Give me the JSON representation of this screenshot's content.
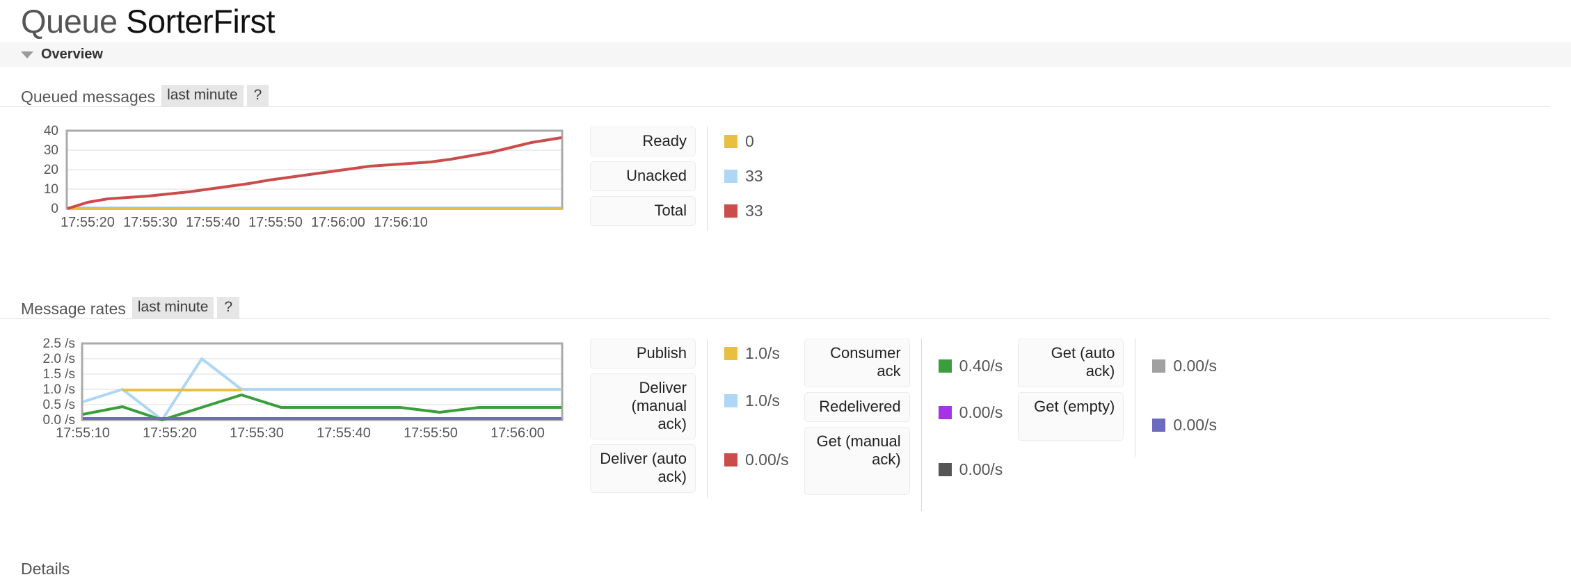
{
  "page": {
    "title_prefix": "Queue",
    "title_name": "SorterFirst",
    "section_title": "Overview",
    "details_title": "Details"
  },
  "colors": {
    "ready": "#e8bf3f",
    "unacked": "#aed6f5",
    "total": "#cc4b4b",
    "publish": "#e8bf3f",
    "deliver_manual": "#aed6f5",
    "deliver_auto": "#cc4b4b",
    "consumer_ack": "#3a9e3a",
    "redelivered": "#a733e8",
    "get_manual": "#555555",
    "get_auto": "#a0a0a0",
    "get_empty": "#6d6bbf"
  },
  "queued_messages": {
    "title": "Queued messages",
    "period": "last minute",
    "help": "?",
    "legend": [
      {
        "label": "Ready",
        "value": "0",
        "color_key": "ready"
      },
      {
        "label": "Unacked",
        "value": "33",
        "color_key": "unacked"
      },
      {
        "label": "Total",
        "value": "33",
        "color_key": "total"
      }
    ]
  },
  "message_rates": {
    "title": "Message rates",
    "period": "last minute",
    "help": "?",
    "legend_groups": [
      [
        {
          "label": "Publish",
          "value": "1.0/s",
          "color_key": "publish"
        },
        {
          "label": "Deliver (manual ack)",
          "value": "1.0/s",
          "color_key": "deliver_manual"
        },
        {
          "label": "Deliver (auto ack)",
          "value": "0.00/s",
          "color_key": "deliver_auto"
        }
      ],
      [
        {
          "label": "Consumer ack",
          "value": "0.40/s",
          "color_key": "consumer_ack"
        },
        {
          "label": "Redelivered",
          "value": "0.00/s",
          "color_key": "redelivered"
        },
        {
          "label": "Get (manual ack)",
          "value": "0.00/s",
          "color_key": "get_manual"
        }
      ],
      [
        {
          "label": "Get (auto ack)",
          "value": "0.00/s",
          "color_key": "get_auto"
        },
        {
          "label": "Get (empty)",
          "value": "0.00/s",
          "color_key": "get_empty"
        }
      ]
    ]
  },
  "chart_data": [
    {
      "type": "line",
      "title": "Queued messages",
      "xlabel": "",
      "ylabel": "",
      "ylim": [
        0,
        40
      ],
      "yticks": [
        0,
        10,
        20,
        30,
        40
      ],
      "ytick_labels": [
        "0",
        "10",
        "20",
        "30",
        "40"
      ],
      "xtick_labels": [
        "17:55:20",
        "17:55:30",
        "17:55:40",
        "17:55:50",
        "17:56:00",
        "17:56:10"
      ],
      "grid": true,
      "legend_position": "right",
      "x": [
        0,
        1,
        2,
        3,
        4,
        5,
        6,
        7,
        8,
        9,
        10,
        11,
        12,
        13,
        14,
        15,
        16,
        17,
        18,
        19,
        20,
        21,
        22,
        23,
        24
      ],
      "series": [
        {
          "name": "Total",
          "color": "#cc4b4b",
          "values": [
            0,
            2,
            4,
            4.6,
            5.2,
            6,
            7,
            8,
            9.2,
            10.5,
            12,
            13.2,
            14.5,
            15.8,
            17,
            18.4,
            19,
            19.6,
            20.2,
            21.6,
            23.2,
            25,
            27.8,
            30.5,
            33
          ]
        },
        {
          "name": "Unacked",
          "color": "#aed6f5",
          "values": [
            0,
            0,
            0,
            0,
            0,
            0,
            0,
            0,
            0,
            0,
            0,
            0,
            0,
            0,
            0,
            0,
            0,
            0,
            0,
            0,
            0,
            0,
            0,
            0,
            0
          ]
        },
        {
          "name": "Ready",
          "color": "#e8bf3f",
          "values": [
            0,
            0,
            0,
            0,
            0,
            0,
            0,
            0,
            0,
            0,
            0,
            0,
            0,
            0,
            0,
            0,
            0,
            0,
            0,
            0,
            0,
            0,
            0,
            0,
            0
          ]
        }
      ]
    },
    {
      "type": "line",
      "title": "Message rates",
      "xlabel": "",
      "ylabel": "",
      "ylim": [
        0.0,
        2.5
      ],
      "yticks": [
        0.0,
        0.5,
        1.0,
        1.5,
        2.0,
        2.5
      ],
      "ytick_labels": [
        "0.0 /s",
        "0.5 /s",
        "1.0 /s",
        "1.5 /s",
        "2.0 /s",
        "2.5 /s"
      ],
      "xtick_labels": [
        "17:55:10",
        "17:55:20",
        "17:55:30",
        "17:55:40",
        "17:55:50",
        "17:56:00"
      ],
      "grid": true,
      "legend_position": "right",
      "x": [
        0,
        1,
        2,
        3,
        4,
        5,
        6,
        7,
        8,
        9,
        10,
        11,
        12
      ],
      "series": [
        {
          "name": "Deliver (manual ack)",
          "color": "#aed6f5",
          "values": [
            0.6,
            1.0,
            0.0,
            2.0,
            1.0,
            1.0,
            1.0,
            1.0,
            1.0,
            1.0,
            1.0,
            1.0,
            1.0
          ]
        },
        {
          "name": "Publish",
          "color": "#e8bf3f",
          "values": [
            null,
            1.0,
            1.0,
            1.0,
            1.0,
            null,
            null,
            null,
            null,
            null,
            null,
            null,
            null
          ]
        },
        {
          "name": "Consumer ack",
          "color": "#3a9e3a",
          "values": [
            0.17,
            0.43,
            0.0,
            0.4,
            0.82,
            0.4,
            0.4,
            0.4,
            0.4,
            0.4,
            0.28,
            0.4,
            0.4
          ]
        },
        {
          "name": "Get (empty)",
          "color": "#6d6bbf",
          "values": [
            0.0,
            0.0,
            0.0,
            0.0,
            0.0,
            0.0,
            0.0,
            0.0,
            0.0,
            0.0,
            0.0,
            0.0,
            0.0
          ]
        }
      ]
    }
  ]
}
